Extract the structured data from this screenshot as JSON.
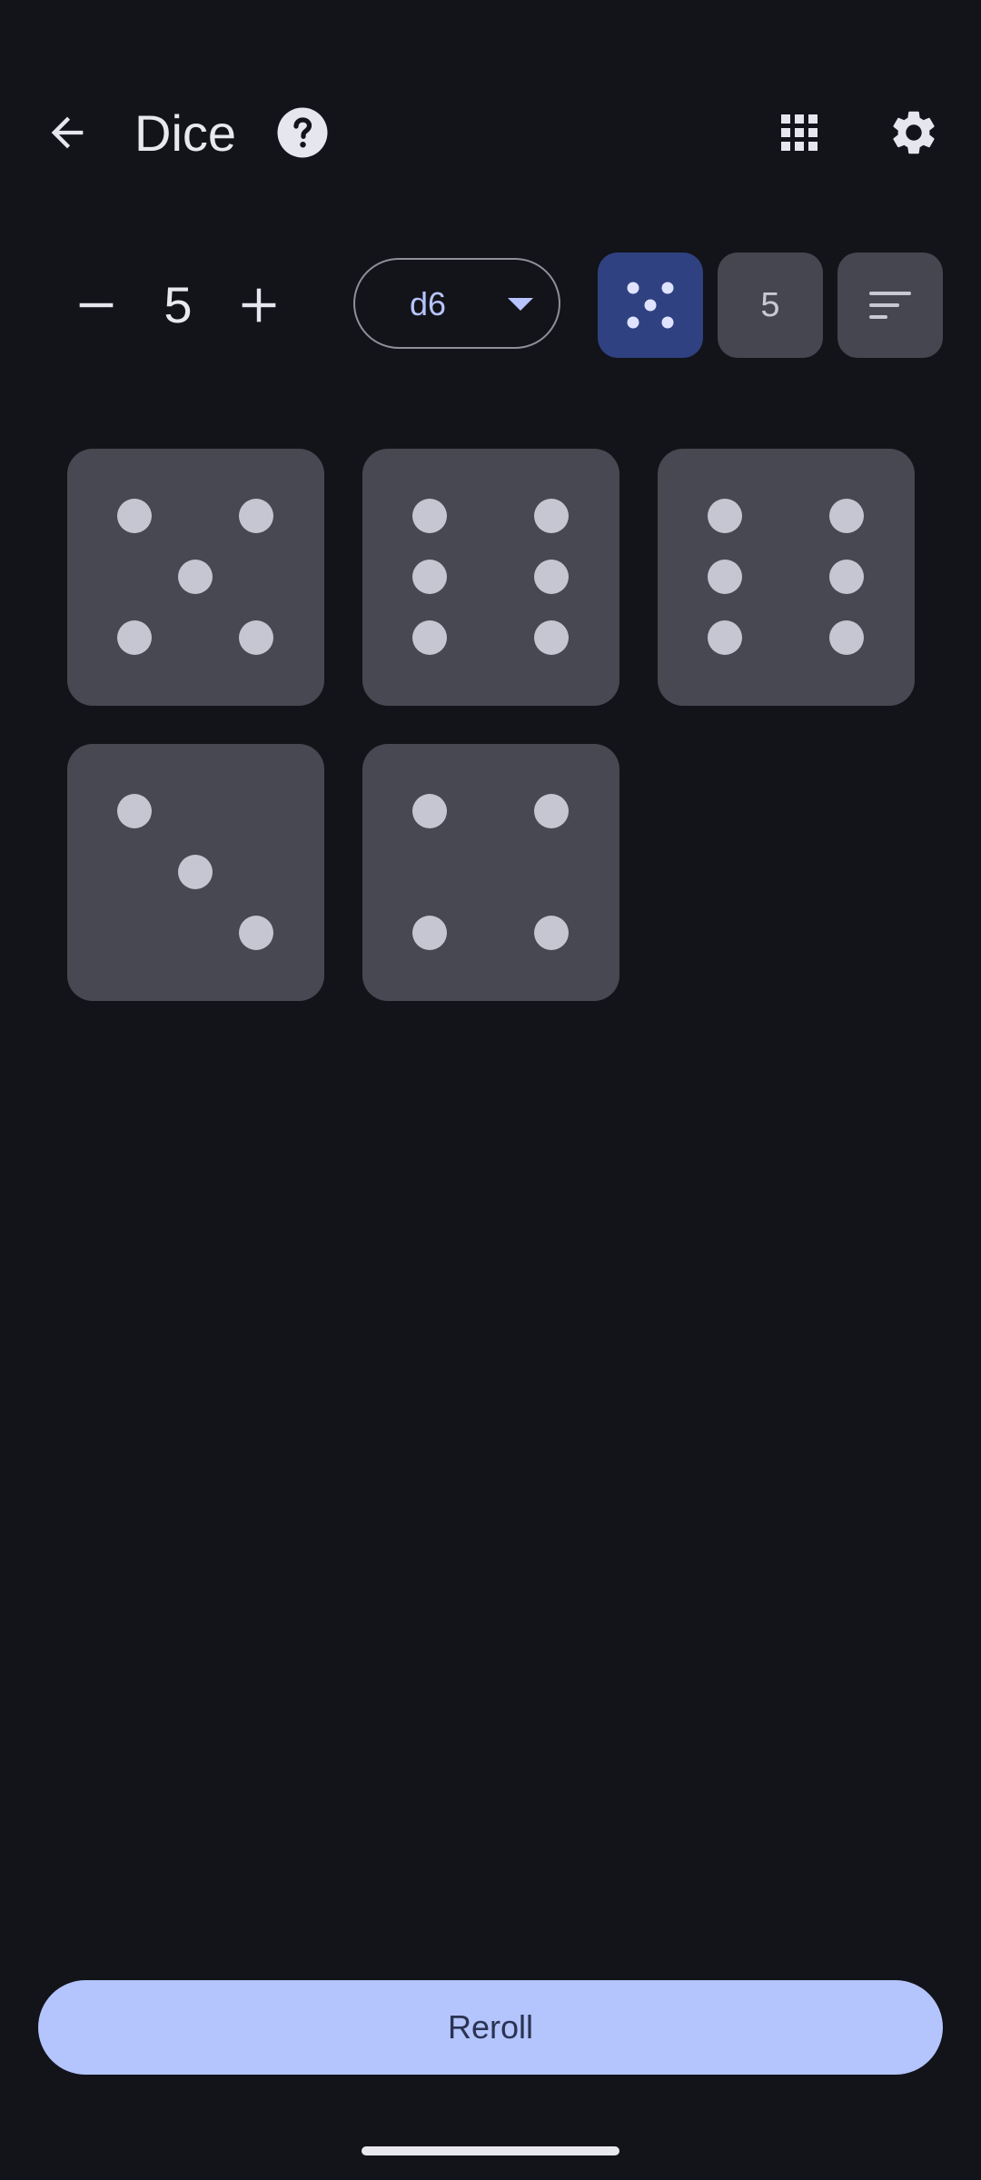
{
  "app_bar": {
    "title": "Dice",
    "icons": [
      "back-arrow-icon",
      "help-icon",
      "grid-icon",
      "gear-icon"
    ]
  },
  "controls": {
    "dice_count": "5",
    "die_type": "d6",
    "modes": [
      {
        "name": "pips",
        "selected": true
      },
      {
        "name": "number",
        "label": "5",
        "selected": false
      },
      {
        "name": "sort",
        "selected": false
      }
    ]
  },
  "dice": [
    5,
    6,
    6,
    3,
    4
  ],
  "colors": {
    "background": "#131419",
    "die": "#474851",
    "pip": "#c5c6d2",
    "accent": "#b4c4fc",
    "selected_mode": "#2f4180"
  },
  "reroll": {
    "label": "Reroll"
  }
}
